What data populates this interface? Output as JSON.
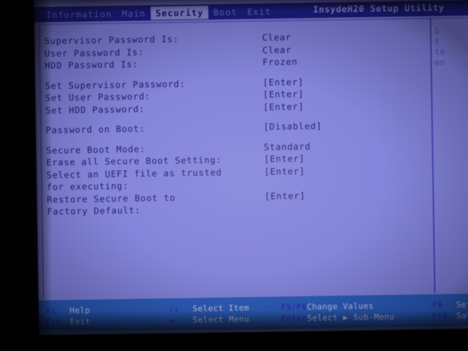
{
  "window": {
    "utility_title": "InsydeH20 Setup Utility"
  },
  "menu": {
    "items": [
      {
        "label": "Information",
        "active": false
      },
      {
        "label": "Main",
        "active": false
      },
      {
        "label": "Security",
        "active": true
      },
      {
        "label": "Boot",
        "active": false
      },
      {
        "label": "Exit",
        "active": false
      }
    ]
  },
  "settings": {
    "groups": [
      {
        "rows": [
          {
            "label": "Supervisor Password Is:",
            "value": "Clear"
          },
          {
            "label": "User Password Is:",
            "value": "Clear"
          },
          {
            "label": "HDD Password Is:",
            "value": "Frozen"
          }
        ]
      },
      {
        "rows": [
          {
            "label": "Set Supervisor Password:",
            "value": "[Enter]"
          },
          {
            "label": "Set User Password:",
            "value": "[Enter]"
          },
          {
            "label": "Set HDD Password:",
            "value": "[Enter]"
          }
        ]
      },
      {
        "rows": [
          {
            "label": "Password on Boot:",
            "value": "[Disabled]"
          }
        ]
      },
      {
        "rows": [
          {
            "label": "Secure Boot Mode:",
            "value": "Standard"
          },
          {
            "label": "Erase all Secure Boot Setting:",
            "value": "[Enter]"
          },
          {
            "label": "Select an UEFI file as trusted",
            "value": "[Enter]"
          },
          {
            "label": "for executing:",
            "value": ""
          },
          {
            "label": "Restore Secure Boot to",
            "value": "[Enter]"
          },
          {
            "label": "Factory Default:",
            "value": ""
          }
        ]
      }
    ]
  },
  "help_pane": {
    "lines": [
      "S",
      "t",
      "to",
      "en"
    ]
  },
  "keybar": {
    "columns": [
      {
        "rows": [
          {
            "key": "F1",
            "desc": "Help"
          },
          {
            "key": "Esc",
            "desc": "Exit"
          }
        ]
      },
      {
        "rows": [
          {
            "key": "↑↓",
            "desc": "Select Item"
          },
          {
            "key": "↔",
            "desc": "Select Menu"
          }
        ]
      },
      {
        "rows": [
          {
            "key": "F5/F6",
            "desc": "Change Values"
          },
          {
            "key": "Enter",
            "desc": "Select ▶ Sub-Menu"
          }
        ]
      },
      {
        "rows": [
          {
            "key": "F9",
            "desc": "Setu"
          },
          {
            "key": "F10",
            "desc": "Save"
          }
        ]
      }
    ]
  },
  "colors": {
    "panel_bg": "#8586da",
    "menubar_bg": "#1d1d7e",
    "menu_active_bg": "#8f90d2",
    "text": "#1b1b63",
    "keybar_bg": "#2b5fb8",
    "key_label": "#2e2eb4",
    "key_desc": "#c9cbe8"
  }
}
